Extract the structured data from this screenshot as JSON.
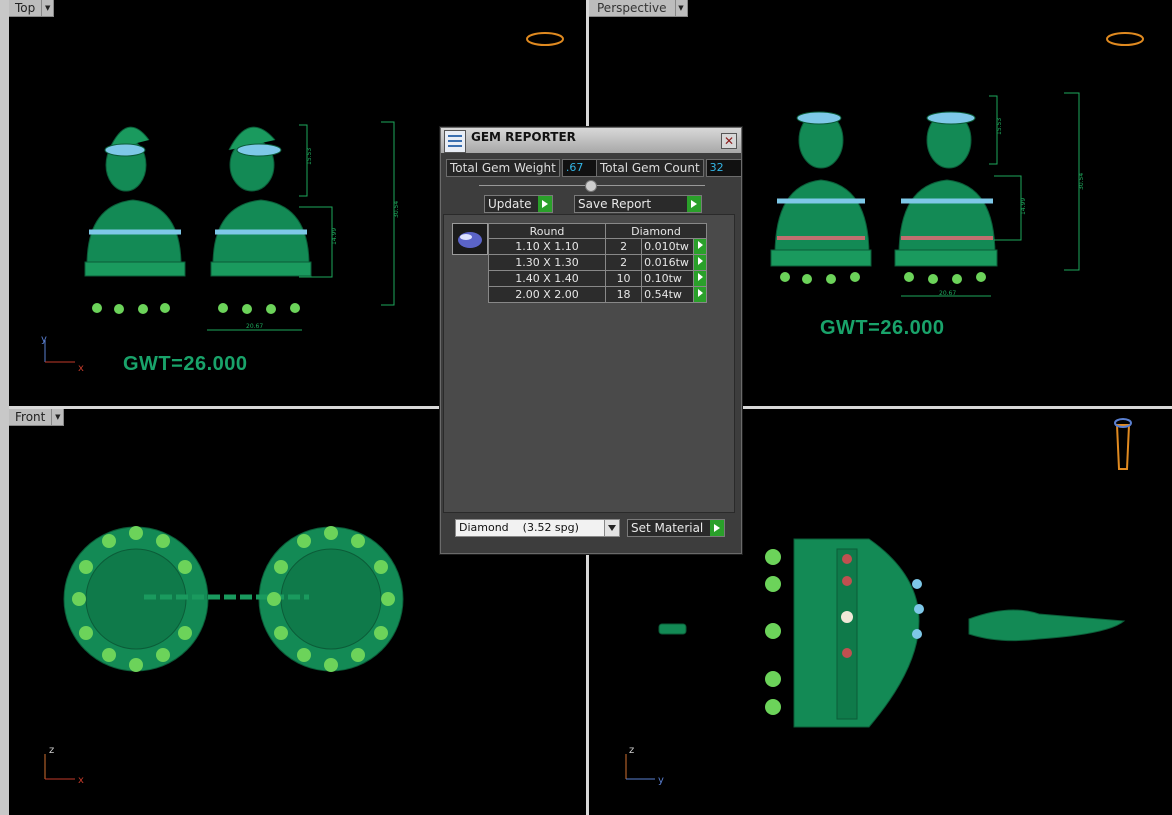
{
  "viewports": {
    "top": {
      "label": "Top",
      "gwt": "GWT=26.000",
      "axis": [
        "y",
        "x"
      ]
    },
    "perspective": {
      "label": "Perspective",
      "gwt": "GWT=26.000"
    },
    "front": {
      "label": "Front",
      "axis": [
        "z",
        "x"
      ]
    },
    "right": {
      "axis": [
        "z",
        "y"
      ]
    }
  },
  "dialog": {
    "title": "GEM REPORTER",
    "total_gem_weight_label": "Total Gem Weight",
    "total_gem_weight_value": ".67",
    "total_gem_count_label": "Total Gem Count",
    "total_gem_count_value": "32",
    "update_label": "Update",
    "save_report_label": "Save Report",
    "table": {
      "col_shape": "Round",
      "col_material": "Diamond",
      "rows": [
        {
          "size": "1.10 X 1.10",
          "count": "2",
          "weight": "0.010tw"
        },
        {
          "size": "1.30 X 1.30",
          "count": "2",
          "weight": "0.016tw"
        },
        {
          "size": "1.40 X 1.40",
          "count": "10",
          "weight": "0.10tw"
        },
        {
          "size": "2.00 X 2.00",
          "count": "18",
          "weight": "0.54tw"
        }
      ]
    },
    "material_select": "Diamond    (3.52 spg)",
    "set_material_label": "Set Material"
  },
  "colors": {
    "model": "#138a55",
    "gem_blue": "#7ec8e8",
    "accent_go": "#2aa02a"
  }
}
